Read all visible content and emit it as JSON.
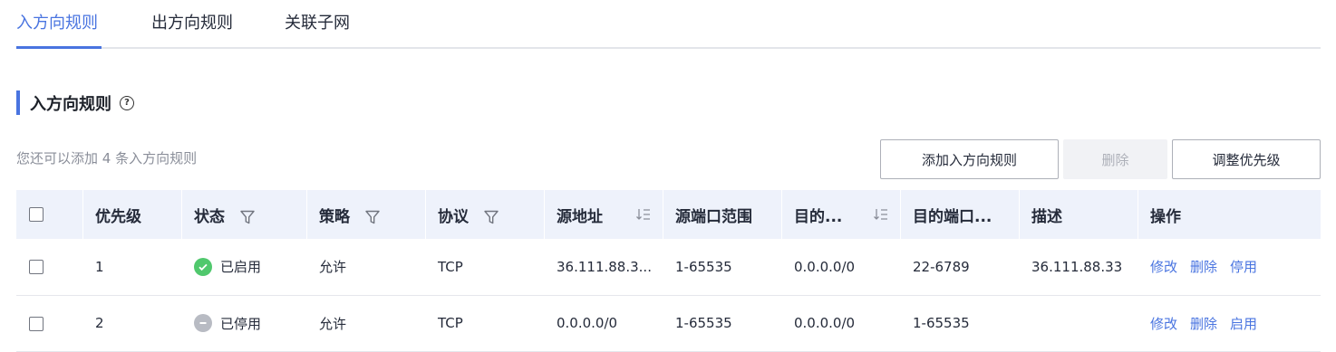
{
  "tabs": [
    {
      "label": "入方向规则",
      "active": true
    },
    {
      "label": "出方向规则",
      "active": false
    },
    {
      "label": "关联子网",
      "active": false
    }
  ],
  "section": {
    "title": "入方向规则"
  },
  "quota_text": "您还可以添加 4 条入方向规则",
  "buttons": {
    "add": "添加入方向规则",
    "delete": "删除",
    "priority": "调整优先级"
  },
  "table": {
    "headers": {
      "priority": "优先级",
      "status": "状态",
      "policy": "策略",
      "protocol": "协议",
      "source": "源地址",
      "source_port": "源端口范围",
      "dest": "目的...",
      "dest_port": "目的端口...",
      "desc": "描述",
      "ops": "操作"
    },
    "rows": [
      {
        "priority": "1",
        "status": "已启用",
        "status_state": "enabled",
        "policy": "允许",
        "protocol": "TCP",
        "source": "36.111.88.3...",
        "source_port": "1-65535",
        "dest": "0.0.0.0/0",
        "dest_port": "22-6789",
        "desc": "36.111.88.33",
        "op_edit": "修改",
        "op_delete": "删除",
        "op_toggle": "停用"
      },
      {
        "priority": "2",
        "status": "已停用",
        "status_state": "disabled",
        "policy": "允许",
        "protocol": "TCP",
        "source": "0.0.0.0/0",
        "source_port": "1-65535",
        "dest": "0.0.0.0/0",
        "dest_port": "1-65535",
        "desc": "",
        "op_edit": "修改",
        "op_delete": "删除",
        "op_toggle": "启用"
      }
    ]
  },
  "colors": {
    "accent": "#4974e0",
    "enabled": "#50c86d",
    "disabled": "#b8bbc3"
  }
}
